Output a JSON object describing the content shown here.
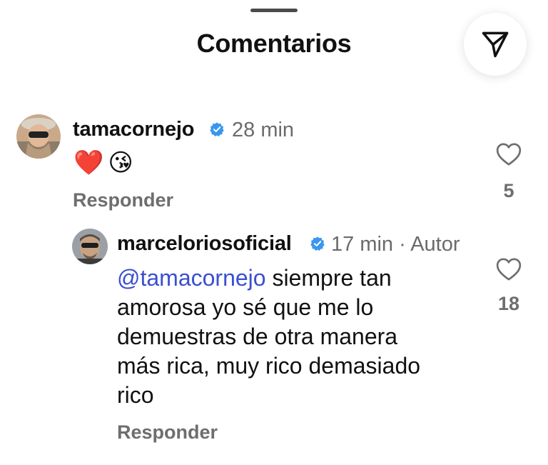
{
  "header": {
    "title": "Comentarios",
    "share_icon": "send-icon"
  },
  "comments": [
    {
      "username": "tamacornejo",
      "verified": true,
      "time": "28 min",
      "emojis": [
        "❤️",
        "😘"
      ],
      "reply_label": "Responder",
      "likes": "5"
    },
    {
      "username": "marceloriosoficial",
      "verified": true,
      "time": "17 min · Autor",
      "mention": "@tamacornejo",
      "text_line1": " siempre tan",
      "text_line2": "amorosa yo sé que me lo",
      "text_line3": "demuestras de otra manera",
      "text_line4": "más rica, muy rico demasiado",
      "text_line5": "rico",
      "reply_label": "Responder",
      "likes": "18"
    }
  ],
  "colors": {
    "verified": "#3897f0",
    "mention": "#3a4fd0",
    "secondary_text": "#6e6e6e"
  }
}
